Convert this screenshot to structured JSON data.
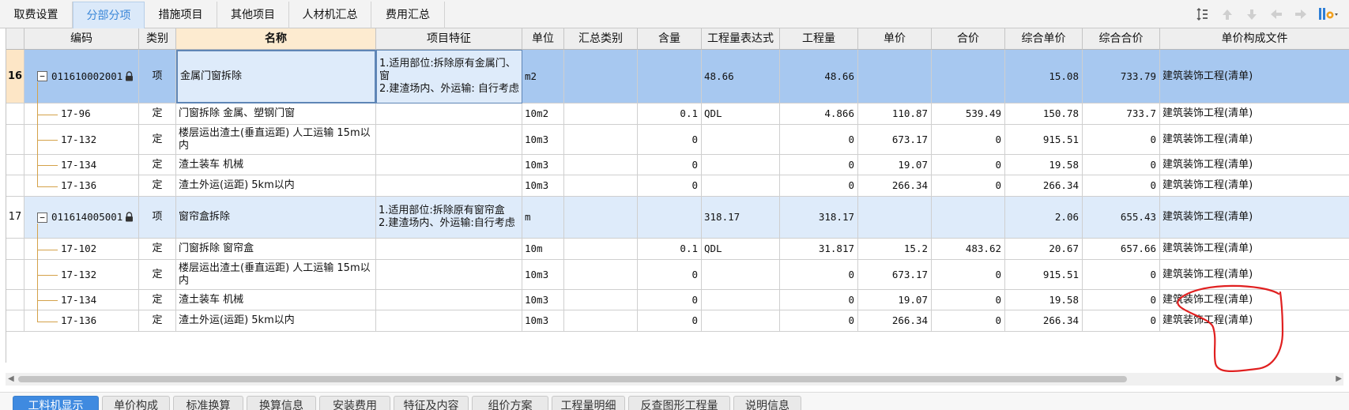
{
  "top_tabs": [
    {
      "label": "取费设置",
      "active": false
    },
    {
      "label": "分部分项",
      "active": true
    },
    {
      "label": "措施项目",
      "active": false
    },
    {
      "label": "其他项目",
      "active": false
    },
    {
      "label": "人材机汇总",
      "active": false
    },
    {
      "label": "费用汇总",
      "active": false
    }
  ],
  "toolbar_icons": [
    "sort-icon",
    "move-up-icon",
    "move-down-icon",
    "move-left-icon",
    "move-right-icon",
    "settings-icon"
  ],
  "columns": [
    "",
    "编码",
    "类别",
    "名称",
    "项目特征",
    "单位",
    "汇总类别",
    "含量",
    "工程量表达式",
    "工程量",
    "单价",
    "合价",
    "综合单价",
    "综合合价",
    "单价构成文件"
  ],
  "rows": [
    {
      "num": "16",
      "kind": "item",
      "selected": true,
      "code": "011610002001",
      "type": "项",
      "name": "金属门窗拆除",
      "feature": "1.适用部位:拆除原有金属门、窗\n2.建渣场内、外运输: 自行考虑",
      "unit": "m2",
      "summary": "",
      "content": "",
      "expr": "48.66",
      "qty": "48.66",
      "price": "",
      "total": "",
      "comp_price": "15.08",
      "comp_total": "733.79",
      "file": "建筑装饰工程(清单)"
    },
    {
      "num": "",
      "kind": "sub",
      "code": "17-96",
      "type": "定",
      "name": "门窗拆除 金属、塑钢门窗",
      "feature": "",
      "unit": "10m2",
      "summary": "",
      "content": "0.1",
      "expr": "QDL",
      "qty": "4.866",
      "price": "110.87",
      "total": "539.49",
      "comp_price": "150.78",
      "comp_total": "733.7",
      "file": "建筑装饰工程(清单)"
    },
    {
      "num": "",
      "kind": "sub",
      "code": "17-132",
      "type": "定",
      "name": "楼层运出渣土(垂直运距) 人工运输 15m以内",
      "feature": "",
      "unit": "10m3",
      "summary": "",
      "content": "0",
      "expr": "",
      "qty": "0",
      "price": "673.17",
      "total": "0",
      "comp_price": "915.51",
      "comp_total": "0",
      "file": "建筑装饰工程(清单)"
    },
    {
      "num": "",
      "kind": "sub",
      "code": "17-134",
      "type": "定",
      "name": "渣土装车 机械",
      "feature": "",
      "unit": "10m3",
      "summary": "",
      "content": "0",
      "expr": "",
      "qty": "0",
      "price": "19.07",
      "total": "0",
      "comp_price": "19.58",
      "comp_total": "0",
      "file": "建筑装饰工程(清单)"
    },
    {
      "num": "",
      "kind": "sub",
      "code": "17-136",
      "type": "定",
      "name": "渣土外运(运距) 5km以内",
      "feature": "",
      "unit": "10m3",
      "summary": "",
      "content": "0",
      "expr": "",
      "qty": "0",
      "price": "266.34",
      "total": "0",
      "comp_price": "266.34",
      "comp_total": "0",
      "file": "建筑装饰工程(清单)"
    },
    {
      "num": "17",
      "kind": "item",
      "selected": false,
      "code": "011614005001",
      "type": "项",
      "name": "窗帘盒拆除",
      "feature": "1.适用部位:拆除原有窗帘盒\n2.建渣场内、外运输:自行考虑",
      "unit": "m",
      "summary": "",
      "content": "",
      "expr": "318.17",
      "qty": "318.17",
      "price": "",
      "total": "",
      "comp_price": "2.06",
      "comp_total": "655.43",
      "file": "建筑装饰工程(清单)"
    },
    {
      "num": "",
      "kind": "sub",
      "code": "17-102",
      "type": "定",
      "name": "门窗拆除 窗帘盒",
      "feature": "",
      "unit": "10m",
      "summary": "",
      "content": "0.1",
      "expr": "QDL",
      "qty": "31.817",
      "price": "15.2",
      "total": "483.62",
      "comp_price": "20.67",
      "comp_total": "657.66",
      "file": "建筑装饰工程(清单)"
    },
    {
      "num": "",
      "kind": "sub",
      "code": "17-132",
      "type": "定",
      "name": "楼层运出渣土(垂直运距) 人工运输 15m以内",
      "feature": "",
      "unit": "10m3",
      "summary": "",
      "content": "0",
      "expr": "",
      "qty": "0",
      "price": "673.17",
      "total": "0",
      "comp_price": "915.51",
      "comp_total": "0",
      "file": "建筑装饰工程(清单)"
    },
    {
      "num": "",
      "kind": "sub",
      "code": "17-134",
      "type": "定",
      "name": "渣土装车 机械",
      "feature": "",
      "unit": "10m3",
      "summary": "",
      "content": "0",
      "expr": "",
      "qty": "0",
      "price": "19.07",
      "total": "0",
      "comp_price": "19.58",
      "comp_total": "0",
      "file": "建筑装饰工程(清单)"
    },
    {
      "num": "",
      "kind": "sub",
      "code": "17-136",
      "type": "定",
      "name": "渣土外运(运距) 5km以内",
      "feature": "",
      "unit": "10m3",
      "summary": "",
      "content": "0",
      "expr": "",
      "qty": "0",
      "price": "266.34",
      "total": "0",
      "comp_price": "266.34",
      "comp_total": "0",
      "file": "建筑装饰工程(清单)"
    }
  ],
  "bottom_tabs": [
    {
      "label": "工料机显示",
      "active": true
    },
    {
      "label": "单价构成",
      "active": false
    },
    {
      "label": "标准换算",
      "active": false
    },
    {
      "label": "换算信息",
      "active": false
    },
    {
      "label": "安装费用",
      "active": false
    },
    {
      "label": "特征及内容",
      "active": false
    },
    {
      "label": "组价方案",
      "active": false
    },
    {
      "label": "工程量明细",
      "active": false
    },
    {
      "label": "反查图形工程量",
      "active": false
    },
    {
      "label": "说明信息",
      "active": false
    }
  ],
  "colors": {
    "accent": "#3f8ae0",
    "selected_row": "#a7c8f0",
    "item_row": "#deebfa",
    "tree_line": "#d4a24a",
    "annotation": "#e02020"
  }
}
